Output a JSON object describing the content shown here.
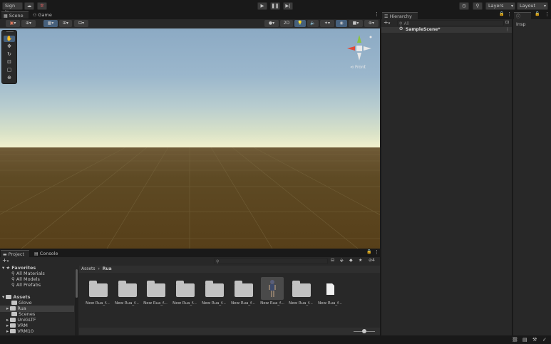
{
  "toolbar": {
    "sign_in": "Sign in",
    "cloud_icon": "cloud-icon",
    "collab_icon": "collab-icon",
    "play_icon": "play-icon",
    "pause_icon": "pause-icon",
    "step_icon": "step-icon",
    "history_icon": "history-icon",
    "search_icon": "search-icon",
    "layers": "Layers",
    "layout": "Layout"
  },
  "scene_tabs": {
    "scene": "Scene",
    "game": "Game"
  },
  "scene_toolbar": {
    "mode_2d": "2D"
  },
  "gizmo": {
    "label": "Front"
  },
  "hierarchy": {
    "tab": "Hierarchy",
    "search_placeholder": "All",
    "scene_name": "SampleScene*"
  },
  "inspector": {
    "tab": "Insp"
  },
  "bottom_tabs": {
    "project": "Project",
    "console": "Console"
  },
  "project": {
    "favorites_label": "Favorites",
    "favorites": [
      "All Materials",
      "All Models",
      "All Prefabs"
    ],
    "assets_label": "Assets",
    "assets_children": [
      "Glove",
      "Rua",
      "Scenes",
      "UniGLTF",
      "VRM",
      "VRM10"
    ],
    "breadcrumb": [
      "Assets",
      "Rua"
    ],
    "hidden_count": "4",
    "items": [
      {
        "label": "New Rua_f...",
        "kind": "folder"
      },
      {
        "label": "New Rua_f...",
        "kind": "folder"
      },
      {
        "label": "New Rua_f...",
        "kind": "folder"
      },
      {
        "label": "New Rua_f...",
        "kind": "folder"
      },
      {
        "label": "New Rua_f...",
        "kind": "folder"
      },
      {
        "label": "New Rua_f...",
        "kind": "folder"
      },
      {
        "label": "New Rua_f...",
        "kind": "model"
      },
      {
        "label": "New Rua_f...",
        "kind": "folder"
      },
      {
        "label": "New Rua_f...",
        "kind": "file"
      }
    ],
    "zoom_fraction": 0.5
  },
  "colors": {
    "accent_blue": "#46607c",
    "panel_bg": "#282828",
    "chrome_bg": "#191919",
    "selection": "#2c5d87"
  }
}
